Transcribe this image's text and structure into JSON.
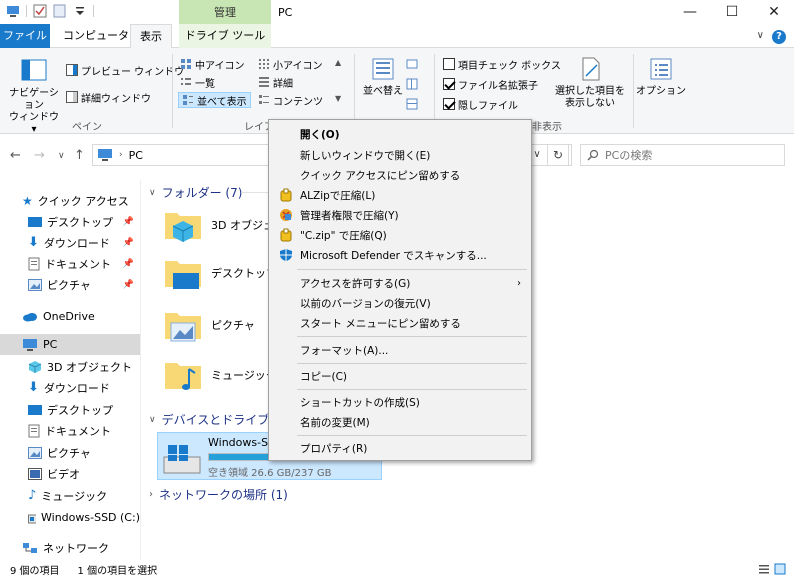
{
  "titlebar": {
    "manage_tab": "管理",
    "title": "PC",
    "minimize": "—",
    "maximize": "☐",
    "close": "✕"
  },
  "tabs": {
    "file": "ファイル",
    "computer": "コンピューター",
    "view": "表示",
    "drive_tools": "ドライブ ツール"
  },
  "ribbon": {
    "nav_pane": "ナビゲーション\nウィンドウ ▾",
    "nav_pane_1": "ナビゲーション",
    "nav_pane_2": "ウィンドウ ▾",
    "preview_pane": "プレビュー ウィンドウ",
    "details_pane": "詳細ウィンドウ",
    "pane_group": "ペイン",
    "medium_icons": "中アイコン",
    "small_icons": "小アイコン",
    "list": "一覧",
    "details": "詳細",
    "tiles": "並べて表示",
    "content": "コンテンツ",
    "layout_group": "レイア",
    "sort_by": "並べ替え",
    "item_checkboxes": "項目チェック ボックス",
    "file_extensions": "ファイル名拡張子",
    "hidden_items": "隠しファイル",
    "hide_selected_1": "選択した項目を",
    "hide_selected_2": "表示しない",
    "show_hide_group": "非表示",
    "options": "オプション"
  },
  "address": {
    "path_root": "PC",
    "search_placeholder": "PCの検索"
  },
  "nav": {
    "quick_access": "クイック アクセス",
    "desktop": "デスクトップ",
    "downloads": "ダウンロード",
    "documents": "ドキュメント",
    "pictures": "ピクチャ",
    "onedrive": "OneDrive",
    "pc": "PC",
    "objects3d": "3D オブジェクト",
    "downloads2": "ダウンロード",
    "desktop2": "デスクトップ",
    "documents2": "ドキュメント",
    "pictures2": "ピクチャ",
    "videos": "ビデオ",
    "music": "ミュージック",
    "windows_ssd": "Windows-SSD (C:)",
    "network": "ネットワーク"
  },
  "content": {
    "folders_header": "フォルダー (7)",
    "folder_3d": "3D オブジェクト",
    "folder_desktop": "デスクトップ",
    "folder_pictures": "ピクチャ",
    "folder_music": "ミュージック",
    "devices_header": "デバイスとドライブ (1",
    "drive_name": "Windows-SS",
    "drive_free": "空き領域 26.6 GB/237 GB",
    "drive_used_fraction": 0.888,
    "network_header": "ネットワークの場所 (1)"
  },
  "status": {
    "item_count": "9 個の項目",
    "selected": "1 個の項目を選択"
  },
  "menu": {
    "open": "開く(O)",
    "open_new_window": "新しいウィンドウで開く(E)",
    "pin_quick_access": "クイック アクセスにピン留めする",
    "alzip": "ALZipで圧縮(L)",
    "alzip_admin": "管理者権限で圧縮(Y)",
    "alzip_czip": "\"C.zip\" で圧縮(Q)",
    "defender": "Microsoft Defender でスキャンする...",
    "give_access": "アクセスを許可する(G)",
    "restore_versions": "以前のバージョンの復元(V)",
    "pin_start": "スタート メニューにピン留めする",
    "format": "フォーマット(A)...",
    "copy": "コピー(C)",
    "create_shortcut": "ショートカットの作成(S)",
    "rename": "名前の変更(M)",
    "properties": "プロパティ(R)"
  },
  "colors": {
    "accent": "#1979ca",
    "manage_green": "#c8e6b4",
    "folder_yellow": "#f8d775",
    "selection": "#cce8ff"
  }
}
